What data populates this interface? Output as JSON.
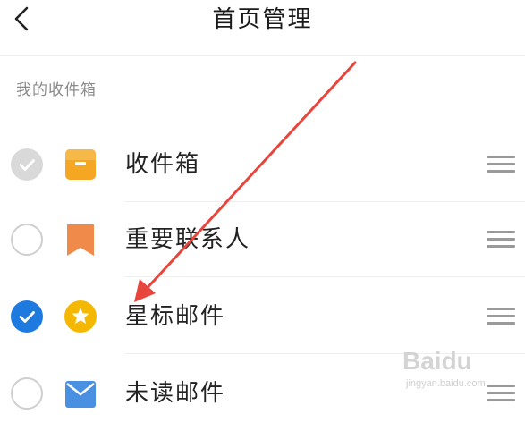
{
  "header": {
    "title": "首页管理",
    "back_icon": "chevron-left-icon"
  },
  "section": {
    "label": "我的收件箱"
  },
  "rows": [
    {
      "label": "收件箱",
      "check_state": "disabled-checked",
      "icon": "inbox-tray-icon",
      "icon_color": "#F5A623"
    },
    {
      "label": "重要联系人",
      "check_state": "unchecked",
      "icon": "bookmark-icon",
      "icon_color": "#F08A4B"
    },
    {
      "label": "星标邮件",
      "check_state": "checked",
      "icon": "star-circle-icon",
      "icon_color": "#F5B800"
    },
    {
      "label": "未读邮件",
      "check_state": "unchecked",
      "icon": "envelope-icon",
      "icon_color": "#4A90E2"
    }
  ],
  "colors": {
    "check_active": "#1F7AE0",
    "check_disabled": "#D9D9D9",
    "annotation_arrow": "#E8453C",
    "divider": "#EEEEEE",
    "secondary_text": "#8A8A8A"
  },
  "watermark": {
    "logo": "Baidu",
    "sub": "jingyan.baidu.com"
  }
}
